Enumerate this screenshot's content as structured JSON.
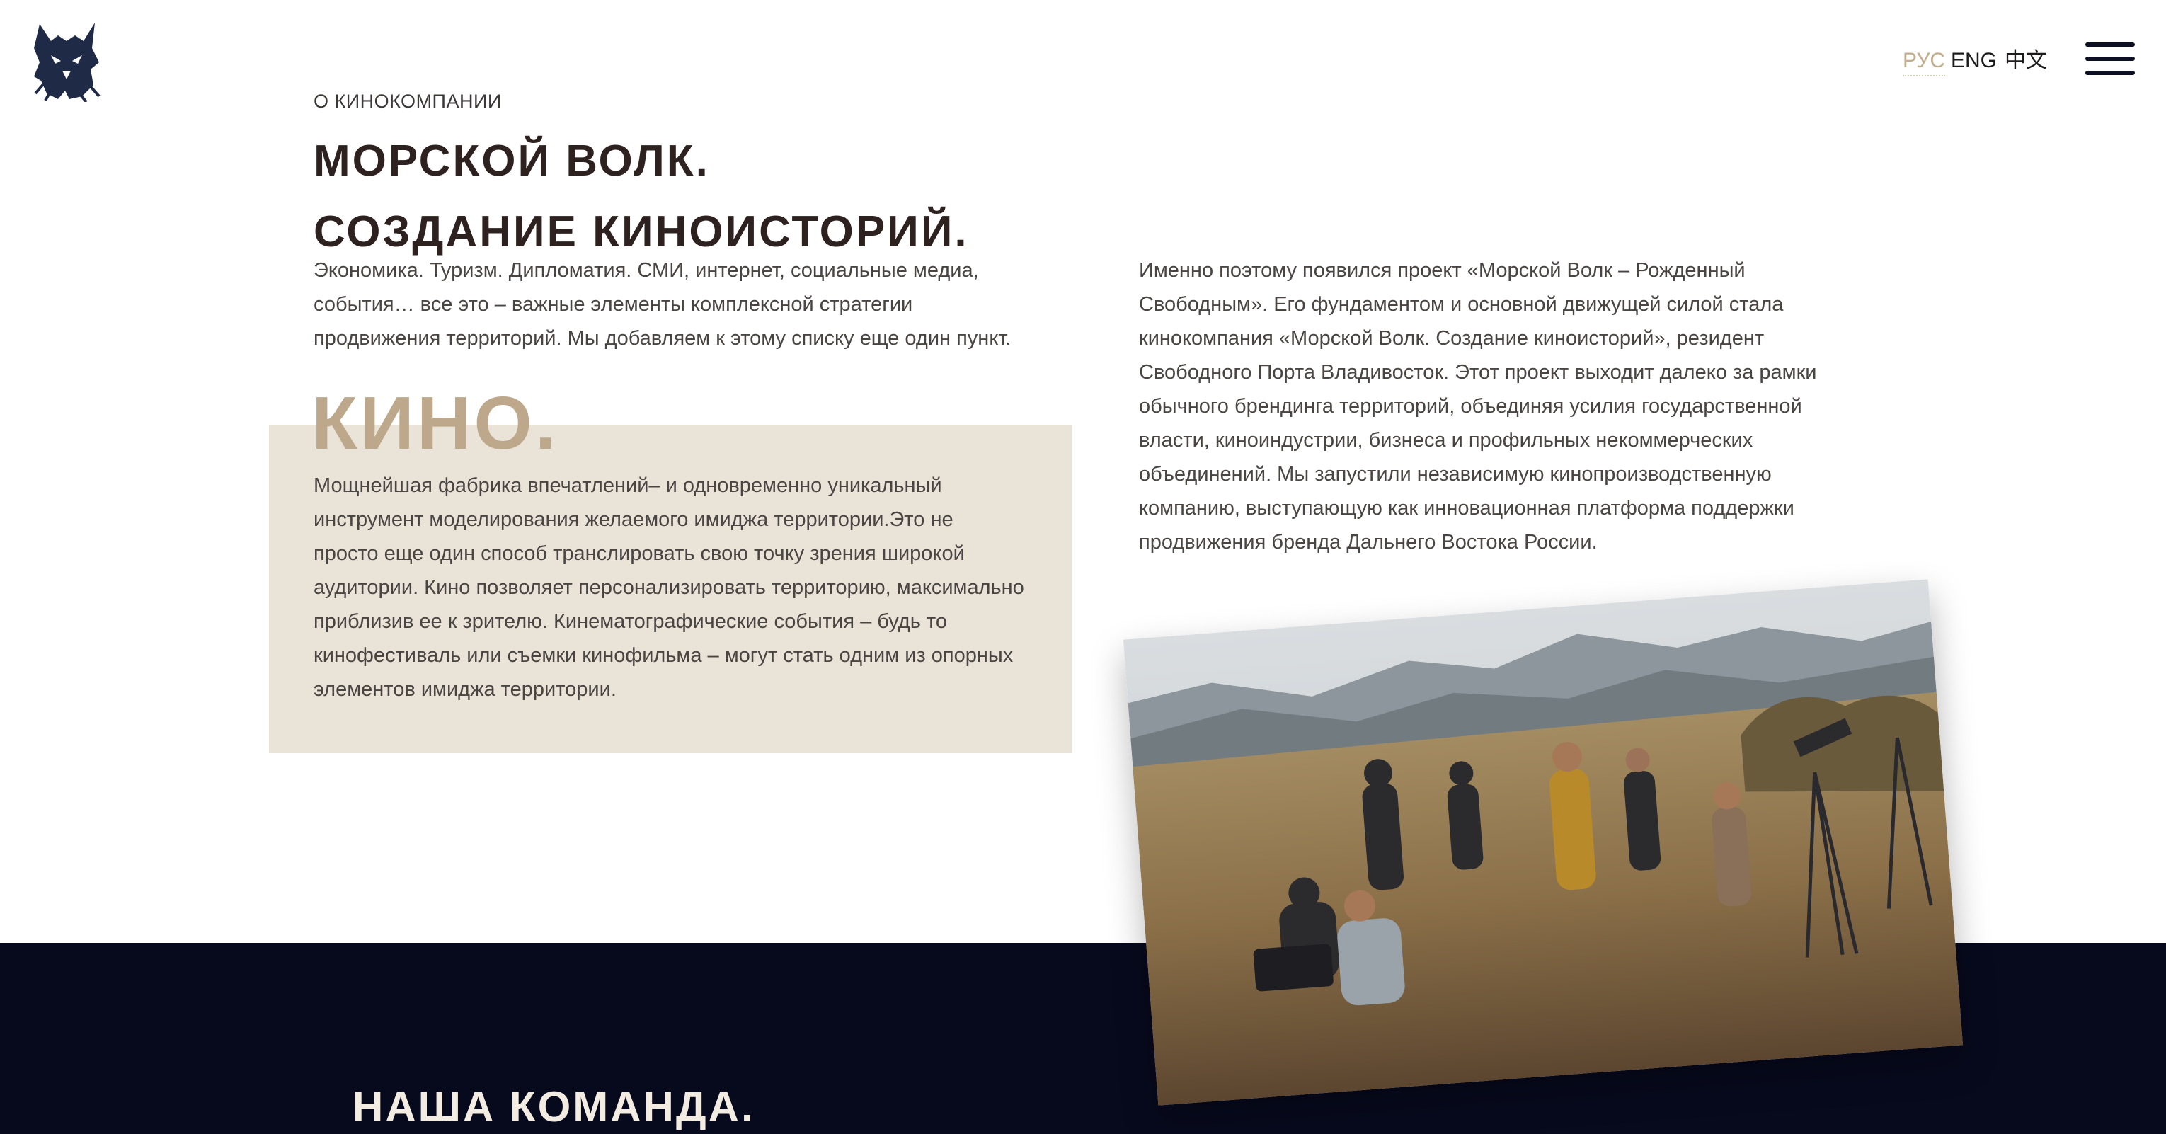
{
  "header": {
    "logo_alt": "wolf-head-logo",
    "languages": [
      {
        "label": "РУС",
        "active": true
      },
      {
        "label": "ENG",
        "active": false
      },
      {
        "label": "中文",
        "active": false
      }
    ],
    "menu_icon": "hamburger-icon"
  },
  "about": {
    "eyebrow": "О КИНОКОМПАНИИ",
    "title_line1": "МОРСКОЙ ВОЛК.",
    "title_line2": "СОЗДАНИЕ КИНОИСТОРИЙ.",
    "intro_lines": [
      "Экономика. Туризм. Дипломатия. СМИ, интернет, социальные медиа,",
      "события… все это – важные элементы комплексной стратегии",
      "продвижения территорий. Мы добавляем к этому списку еще один пункт."
    ],
    "kino_heading": "КИНО.",
    "kino_lines": [
      "Мощнейшая фабрика впечатлений– и одновременно уникальный",
      "инструмент моделирования желаемого имиджа территории.Это не",
      "просто еще один способ транслировать свою точку зрения широкой",
      "аудитории. Кино позволяет персонализировать территорию, максимально",
      "приблизив ее к зрителю. Кинематографические события – будь то",
      "кинофестиваль или съемки кинофильма – могут стать одним из опорных",
      "элементов имиджа территории."
    ],
    "right_lines": [
      "Именно поэтому появился проект «Морской Волк – Рожденный",
      "Свободным». Его фундаментом и основной движущей силой стала",
      "кинокомпания «Морской Волк. Создание киноисторий», резидент",
      "Свободного Порта Владивосток. Этот проект выходит далеко за рамки",
      "обычного брендинга территорий, объединяя усилия государственной",
      "власти, киноиндустрии, бизнеса и профильных некоммерческих",
      "объединений. Мы запустили независимую кинопроизводственную",
      "компанию, выступающую как инновационная платформа поддержки",
      "продвижения бренда Дальнего Востока России."
    ]
  },
  "team": {
    "heading": "НАША КОМАНДА."
  },
  "colors": {
    "accent": "#c2ad8e",
    "beige": "#e9e3d8",
    "title": "#2e2221",
    "dark_band": "#070a1d"
  }
}
